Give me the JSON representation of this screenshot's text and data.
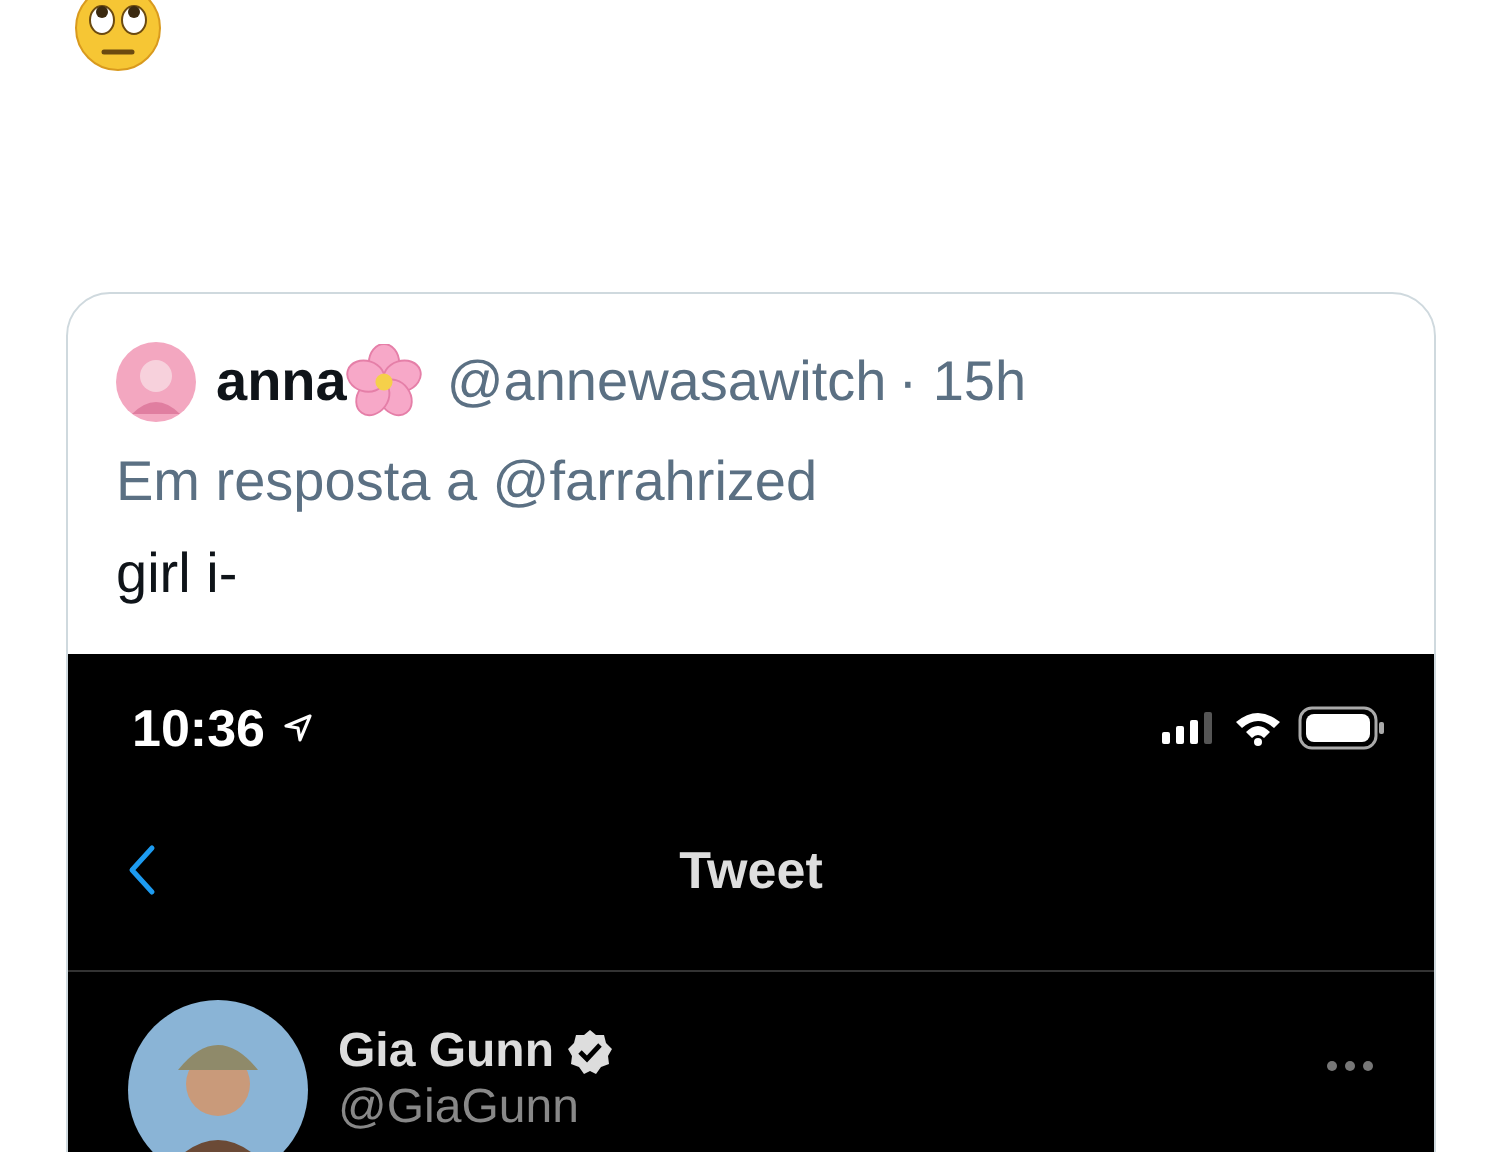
{
  "quoted_tweet": {
    "author": {
      "name": "anna",
      "handle": "@annewasawitch",
      "time": "· 15h"
    },
    "reply_to": "Em resposta a @farrahrized",
    "text": "girl i-",
    "screenshot": {
      "status_bar": {
        "time": "10:36"
      },
      "nav": {
        "title": "Tweet"
      },
      "tweet": {
        "name": "Gia Gunn",
        "verified": true,
        "handle": "@GiaGunn"
      }
    }
  }
}
